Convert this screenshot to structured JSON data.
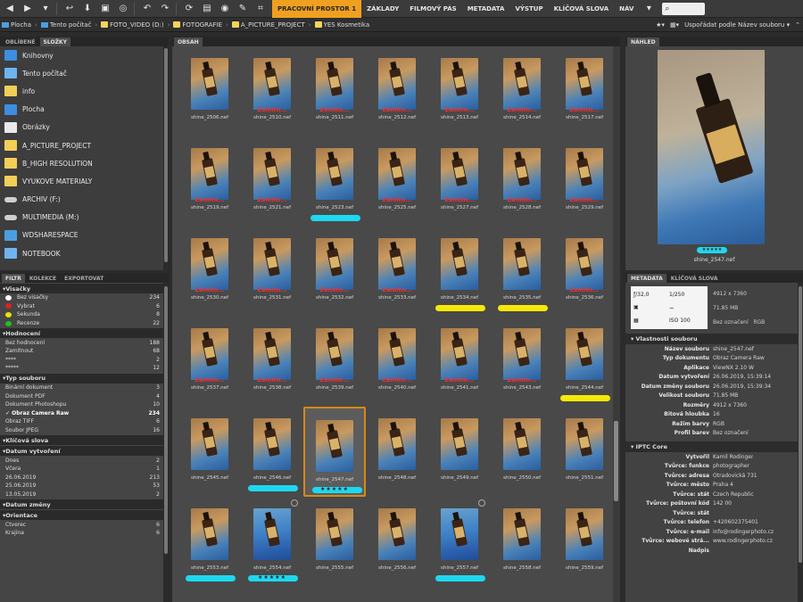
{
  "toolbar": {
    "workspaces": [
      "PRACOVNÍ PROSTOR 1",
      "ZÁKLADY",
      "FILMOVÝ PÁS",
      "METADATA",
      "VÝSTUP",
      "KLÍČOVÁ SLOVA",
      "NÁV"
    ],
    "active_workspace": "PRACOVNÍ PROSTOR 1"
  },
  "pathbar": {
    "crumbs": [
      "Plocha",
      "Tento počítač",
      "FOTO_VIDEO (D:)",
      "FOTOGRAFIE",
      "A_PICTURE_PROJECT",
      "YES Kosmetika"
    ],
    "sort_label": "Uspořádat podle Název souboru"
  },
  "folders_panel": {
    "tabs": [
      "OBLÍBENÉ",
      "SLOŽKY"
    ],
    "items": [
      {
        "label": "Knihovny",
        "icon": "library-icon"
      },
      {
        "label": "Tento počítač",
        "icon": "computer-icon"
      },
      {
        "label": "info",
        "icon": "folder-icon"
      },
      {
        "label": "Plocha",
        "icon": "desktop-icon"
      },
      {
        "label": "Obrázky",
        "icon": "pictures-icon"
      },
      {
        "label": "A_PICTURE_PROJECT",
        "icon": "folder-icon"
      },
      {
        "label": "B_HIGH RESOLUTION",
        "icon": "folder-icon"
      },
      {
        "label": "VYUKOVE MATERIALY",
        "icon": "folder-icon"
      },
      {
        "label": "ARCHIV (F:)",
        "icon": "drive-icon"
      },
      {
        "label": "MULTIMEDIA (M:)",
        "icon": "drive-icon"
      },
      {
        "label": "WDSHARESPACE",
        "icon": "network-icon"
      },
      {
        "label": "NOTEBOOK",
        "icon": "computer-icon"
      }
    ]
  },
  "filter_panel": {
    "tabs": [
      "FILTR",
      "KOLEKCE",
      "EXPORTOVAT"
    ],
    "sections": [
      {
        "title": "Visačky",
        "rows": [
          {
            "label": "Bez visačky",
            "count": "234",
            "dot": "#ffffff"
          },
          {
            "label": "Vybrat",
            "count": "6",
            "dot": "#e02020"
          },
          {
            "label": "Sekunda",
            "count": "8",
            "dot": "#f0e000"
          },
          {
            "label": "Recenze",
            "count": "22",
            "dot": "#20c020"
          }
        ]
      },
      {
        "title": "Hodnocení",
        "rows": [
          {
            "label": "Bez hodnocení",
            "count": "188"
          },
          {
            "label": "Zamítnout",
            "count": "68"
          },
          {
            "label": "****",
            "count": "2"
          },
          {
            "label": "*****",
            "count": "12"
          }
        ]
      },
      {
        "title": "Typ souboru",
        "rows": [
          {
            "label": "Binární dokument",
            "count": "3"
          },
          {
            "label": "Dokument PDF",
            "count": "4"
          },
          {
            "label": "Dokument Photoshopu",
            "count": "10"
          },
          {
            "label": "Obraz Camera Raw",
            "count": "234",
            "bold": true
          },
          {
            "label": "Obraz TIFF",
            "count": "6"
          },
          {
            "label": "Soubor JPEG",
            "count": "16"
          }
        ]
      },
      {
        "title": "Klíčová slova",
        "rows": []
      },
      {
        "title": "Datum vytvoření",
        "rows": [
          {
            "label": "Dnes",
            "count": "2"
          },
          {
            "label": "Včera",
            "count": "1"
          },
          {
            "label": "26.06.2019",
            "count": "213"
          },
          {
            "label": "25.06.2019",
            "count": "53"
          },
          {
            "label": "13.05.2019",
            "count": "2"
          }
        ]
      },
      {
        "title": "Datum změny",
        "rows": []
      },
      {
        "title": "Orientace",
        "rows": [
          {
            "label": "Čtverec",
            "count": "6"
          },
          {
            "label": "Krajina",
            "count": "6"
          }
        ]
      }
    ]
  },
  "content_panel": {
    "tab": "OBSAH",
    "reject_label": "Zamítn...",
    "rows": [
      {
        "files": [
          "shine_2506.nef",
          "shine_2510.nef",
          "shine_2511.nef",
          "shine_2512.nef",
          "shine_2513.nef",
          "shine_2514.nef",
          "shine_2517.nef"
        ],
        "rejected": [
          1,
          2,
          3,
          4,
          5,
          6
        ],
        "marks": {}
      },
      {
        "files": [
          "shine_2519.nef",
          "shine_2521.nef",
          "shine_2523.nef",
          "shine_2525.nef",
          "shine_2527.nef",
          "shine_2528.nef",
          "shine_2529.nef"
        ],
        "rejected": [
          0,
          1,
          3,
          4,
          5,
          6
        ],
        "marks": {
          "2": "cyan"
        }
      },
      {
        "files": [
          "shine_2530.nef",
          "shine_2531.nef",
          "shine_2532.nef",
          "shine_2533.nef",
          "shine_2534.nef",
          "shine_2535.nef",
          "shine_2536.nef"
        ],
        "rejected": [
          0,
          1,
          2,
          3,
          6
        ],
        "marks": {
          "4": "yellow",
          "5": "yellow"
        }
      },
      {
        "files": [
          "shine_2537.nef",
          "shine_2538.nef",
          "shine_2539.nef",
          "shine_2540.nef",
          "shine_2541.nef",
          "shine_2543.nef",
          "shine_2544.nef"
        ],
        "rejected": [
          0,
          1,
          2,
          3,
          4,
          5
        ],
        "marks": {
          "6": "yellow"
        }
      },
      {
        "files": [
          "shine_2545.nef",
          "shine_2546.nef",
          "shine_2547.nef",
          "shine_2548.nef",
          "shine_2549.nef",
          "shine_2550.nef",
          "shine_2551.nef"
        ],
        "rejected": [],
        "marks": {
          "1": "cyan",
          "2": "cyan-stars"
        }
      },
      {
        "files": [
          "shine_2553.nef",
          "shine_2554.nef",
          "shine_2555.nef",
          "shine_2556.nef",
          "shine_2557.nef",
          "shine_2558.nef",
          "shine_2559.nef"
        ],
        "rejected": [],
        "marks": {
          "0": "cyan",
          "1": "cyan-stars",
          "4": "cyan"
        }
      }
    ],
    "selected": "shine_2547.nef",
    "stars": "★★★★★"
  },
  "preview_panel": {
    "tab": "NÁHLED",
    "filename": "shine_2547.nef"
  },
  "metadata_panel": {
    "tabs": [
      "METADATA",
      "KLÍČOVÁ SLOVA"
    ],
    "camera": {
      "aperture": "ƒ/32,0",
      "shutter": "1/250",
      "iso": "ISO 100",
      "dimensions": "4912 x 7360",
      "size": "71.85 MB",
      "profile": "Bez označení",
      "mode": "RGB"
    },
    "file_section": {
      "title": "Vlastnosti souboru",
      "rows": [
        {
          "k": "Název souboru",
          "v": "shine_2547.nef"
        },
        {
          "k": "Typ dokumentu",
          "v": "Obraz Camera Raw"
        },
        {
          "k": "Aplikace",
          "v": "ViewNX 2.10 W"
        },
        {
          "k": "Datum vytvoření",
          "v": "26.06.2019, 15:39:14"
        },
        {
          "k": "Datum změny souboru",
          "v": "26.06.2019, 15:39:34"
        },
        {
          "k": "Velikost souboru",
          "v": "71.85 MB"
        },
        {
          "k": "Rozměry",
          "v": "4912 x 7360"
        },
        {
          "k": "Bitová hloubka",
          "v": "16"
        },
        {
          "k": "Režim barvy",
          "v": "RGB"
        },
        {
          "k": "Profil barev",
          "v": "Bez označení"
        }
      ]
    },
    "iptc_section": {
      "title": "IPTC Core",
      "rows": [
        {
          "k": "Vytvořil",
          "v": "Kamil Rodinger"
        },
        {
          "k": "Tvůrce: funkce",
          "v": "photographer"
        },
        {
          "k": "Tvůrce: adresa",
          "v": "Otradovická 731"
        },
        {
          "k": "Tvůrce: město",
          "v": "Praha 4"
        },
        {
          "k": "Tvůrce: stát",
          "v": "Czech Republic"
        },
        {
          "k": "Tvůrce: poštovní kód",
          "v": "142 00"
        },
        {
          "k": "Tvůrce: stát",
          "v": ""
        },
        {
          "k": "Tvůrce: telefon",
          "v": "+420602375401"
        },
        {
          "k": "Tvůrce: e-mail",
          "v": "info@rodingerphoto.cz"
        },
        {
          "k": "Tvůrce: webové strá...",
          "v": "www.rodingerphoto.cz"
        },
        {
          "k": "Nadpis",
          "v": ""
        }
      ]
    }
  }
}
